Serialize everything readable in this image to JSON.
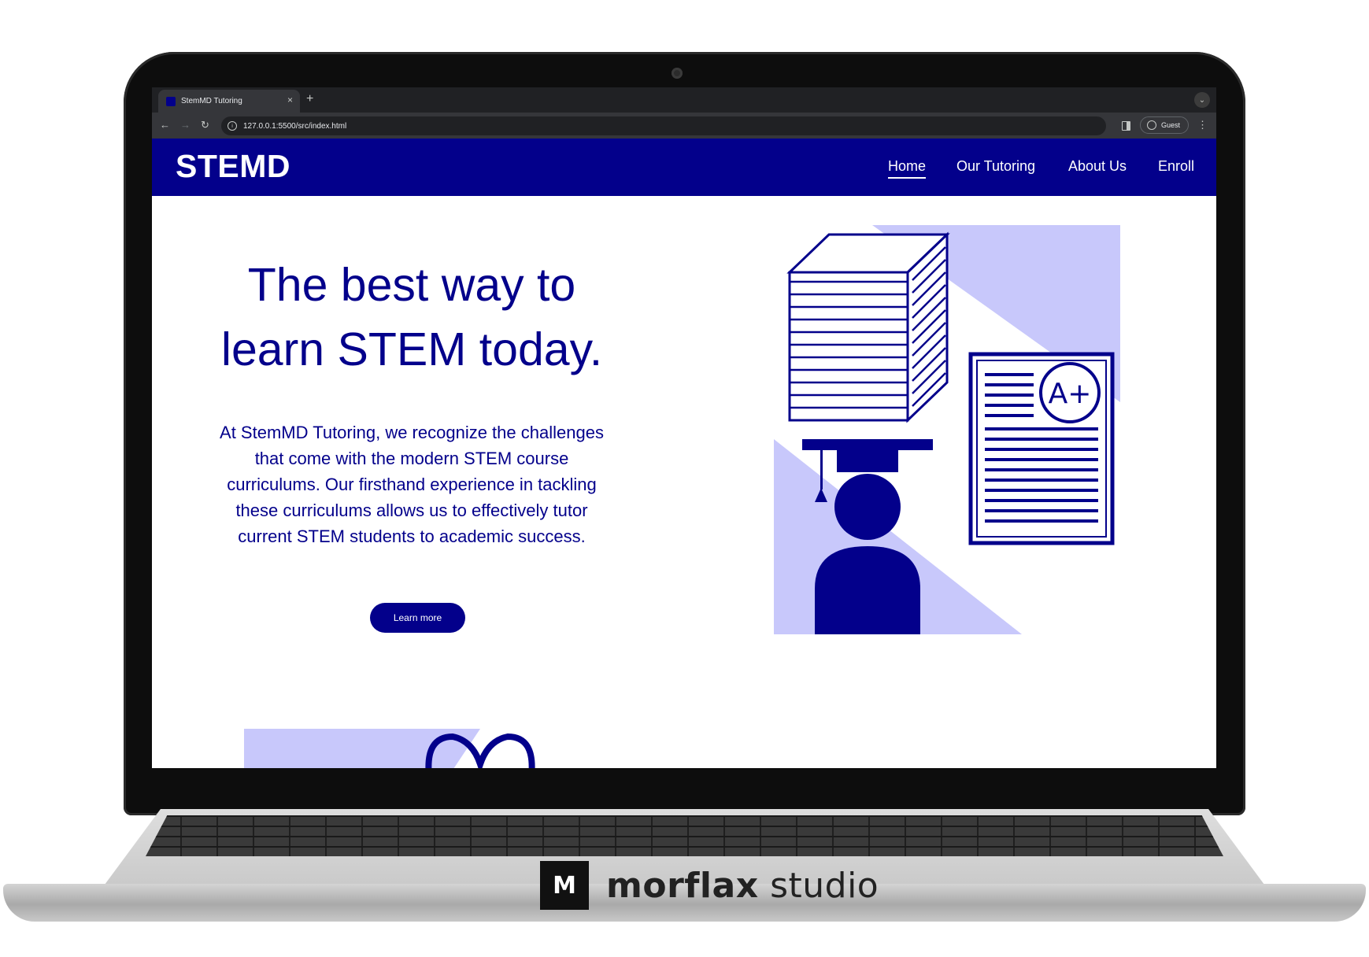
{
  "browser": {
    "tab_title": "StemMD Tutoring",
    "tab_close": "×",
    "new_tab": "+",
    "url": "127.0.0.1:5500/src/index.html",
    "profile": "Guest",
    "back": "←",
    "forward": "→",
    "reload": "↻",
    "menu": "⋮",
    "tab_list": "⌄"
  },
  "site": {
    "logo": "STEMD",
    "nav": [
      {
        "label": "Home",
        "active": true
      },
      {
        "label": "Our Tutoring",
        "active": false
      },
      {
        "label": "About Us",
        "active": false
      },
      {
        "label": "Enroll",
        "active": false
      }
    ],
    "hero": {
      "title_line1": "The best way to",
      "title_line2": "learn STEM today.",
      "body": "At StemMD Tutoring, we recognize the challenges that come with the modern STEM course curriculums. Our firsthand experience in tackling these curriculums allows us to effectively tutor current STEM students to academic success.",
      "cta": "Learn more"
    },
    "illustration": {
      "grade": "A+"
    },
    "colors": {
      "primary": "#03008b",
      "accent_light": "#c8c8fb"
    }
  },
  "watermark": {
    "logo_glyph": "M",
    "brand_bold": "morflax",
    "brand_light": "studio"
  }
}
